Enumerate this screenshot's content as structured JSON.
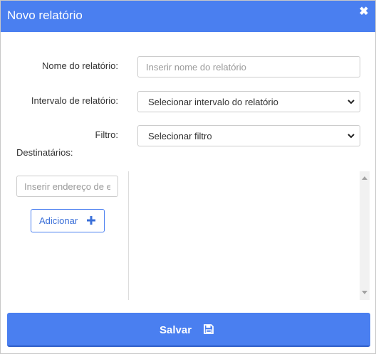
{
  "dialog": {
    "title": "Novo relatório",
    "close_icon": "close-icon"
  },
  "form": {
    "report_name": {
      "label": "Nome do relatório:",
      "placeholder": "Inserir nome do relatório",
      "value": ""
    },
    "interval": {
      "label": "Intervalo de relatório:",
      "selected": "Selecionar intervalo do relatório"
    },
    "filter": {
      "label": "Filtro:",
      "selected": "Selecionar filtro"
    },
    "recipients": {
      "label": "Destinatários:",
      "input_placeholder": "Inserir endereço de e-mail",
      "add_label": "Adicionar",
      "items": []
    }
  },
  "footer": {
    "save_label": "Salvar"
  },
  "colors": {
    "accent": "#4a7ff0",
    "header_text": "#ffffff"
  }
}
